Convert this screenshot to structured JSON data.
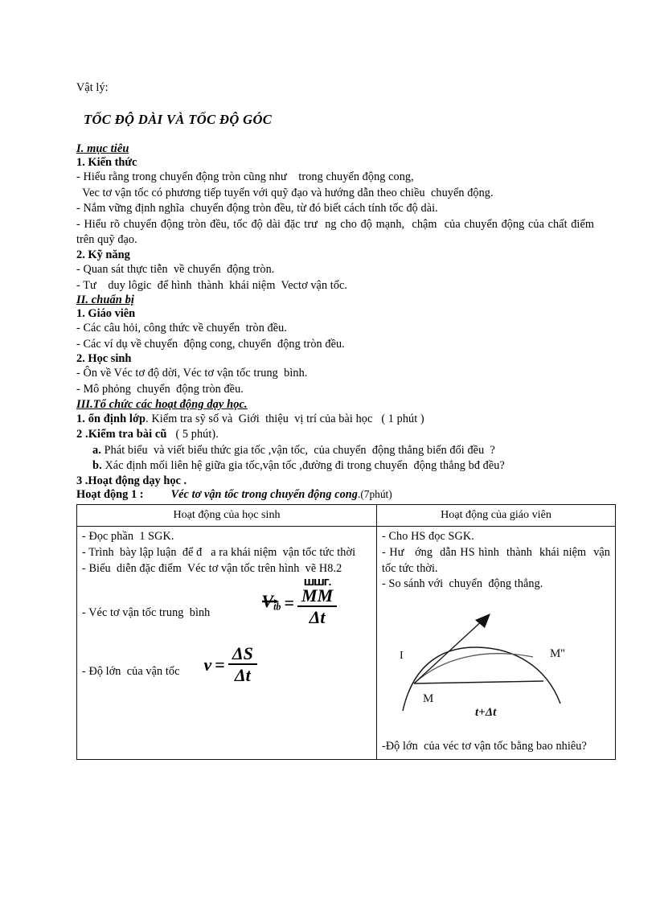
{
  "document": {
    "subject": "Vật lý:",
    "title": "TỐC ĐỘ DÀI VÀ TỐC ĐỘ GÓC",
    "sections": [
      {
        "heading": "I.  mục tiêu",
        "sub": [
          {
            "heading": "1. Kiến thức",
            "lines": [
              "- Hiểu rằng trong chuyển động tròn cũng như    trong chuyển động cong,",
              "  Vec tơ vận tốc có phương tiếp tuyến với quỹ đạo và hướng dẫn theo chiều  chuyển động.",
              "- Nắm vững định nghĩa  chuyển động tròn đều, từ đó biết cách tính tốc độ dài.",
              "- Hiểu rõ chuyển động tròn đều, tốc độ dài đặc trư  ng cho độ mạnh,  chậm  của chuyển động của chất điểm trên quỹ đạo."
            ]
          },
          {
            "heading": "2. Kỹ năng",
            "lines": [
              "- Quan sát thực tiễn  về chuyển  động tròn.",
              "- Tư    duy lôgic  để hình  thành  khái niệm  Vectơ vận tốc."
            ]
          }
        ]
      },
      {
        "heading": "II. chuẩn bị",
        "sub": [
          {
            "heading": "1. Giáo viên",
            "lines": [
              "- Các câu hỏi, công thức về chuyển  tròn đều.",
              "- Các ví dụ về chuyển  động cong, chuyển  động tròn đều."
            ]
          },
          {
            "heading": "2. Học sinh",
            "lines": [
              "- Ôn về Véc tơ độ dời, Véc tơ vận tốc trung  bình.",
              "- Mô phỏng  chuyển  động tròn đều."
            ]
          }
        ]
      }
    ],
    "section3": {
      "heading": "III.Tổ chức các hoạt động dạy học.",
      "items": [
        {
          "bold": "1. ổn định lớp",
          "rest": ". Kiểm tra sỹ số và  Giới  thiệu  vị trí của bài học   ( 1 phút )"
        },
        {
          "bold": "2 .Kiểm tra bài cũ",
          "rest": "   ( 5 phút)."
        }
      ],
      "questions": [
        {
          "label": "a.",
          "text": " Phát biểu  và viết biểu thức gia tốc ,vận tốc,  của chuyển  động thẳng biến đổi đều  ?"
        },
        {
          "label": "b.",
          "text": " Xác định mối liên hệ giữa gia tốc,vận tốc ,đường đi trong chuyển  động thẳng bđ đều?"
        }
      ],
      "activities_heading": "3 .Hoạt động dạy học .",
      "activity": {
        "label": "Hoạt động 1 :",
        "title": "Véc tơ vận tốc trong chuyển động cong",
        "time": ".(7phút)"
      }
    },
    "table": {
      "headers": [
        "Hoạt động của học sinh",
        "Hoạt động của giáo  viên"
      ],
      "left_cell": {
        "lines": [
          "- Đọc phần  1 SGK.",
          "- Trình  bày lập luận  để đ   a ra khái niệm  vận tốc tức thời",
          "- Biểu  diễn đặc điểm  Véc tơ vận tốc trên hình  vẽ H8.2"
        ],
        "formula1_label": "- Véc tơ vận tốc trung  bình",
        "formula1": {
          "lhs_var": "V",
          "lhs_sub": "tb",
          "numerator": "MM",
          "numerator_prime": "'",
          "denominator": "Δt",
          "garbled_overline": "ШШГ."
        },
        "formula2_label": "- Độ lớn  của vận tốc",
        "formula2": {
          "lhs_var": "v",
          "numerator": "ΔS",
          "denominator": "Δt"
        }
      },
      "right_cell": {
        "lines": [
          "- Cho HS đọc SGK.",
          "- Hư   ớng  dẫn HS hình  thành  khái niệm  vận tốc tức thời.",
          "- So sánh với  chuyển  động thẳng."
        ],
        "diagram": {
          "labels": {
            "left_tick": "I",
            "point_m": "M",
            "point_m_prime": "M''",
            "time_label": "t+Δt"
          }
        },
        "last_line": "-Độ lớn  của véc tơ vận tốc bằng bao nhiêu?"
      }
    }
  }
}
